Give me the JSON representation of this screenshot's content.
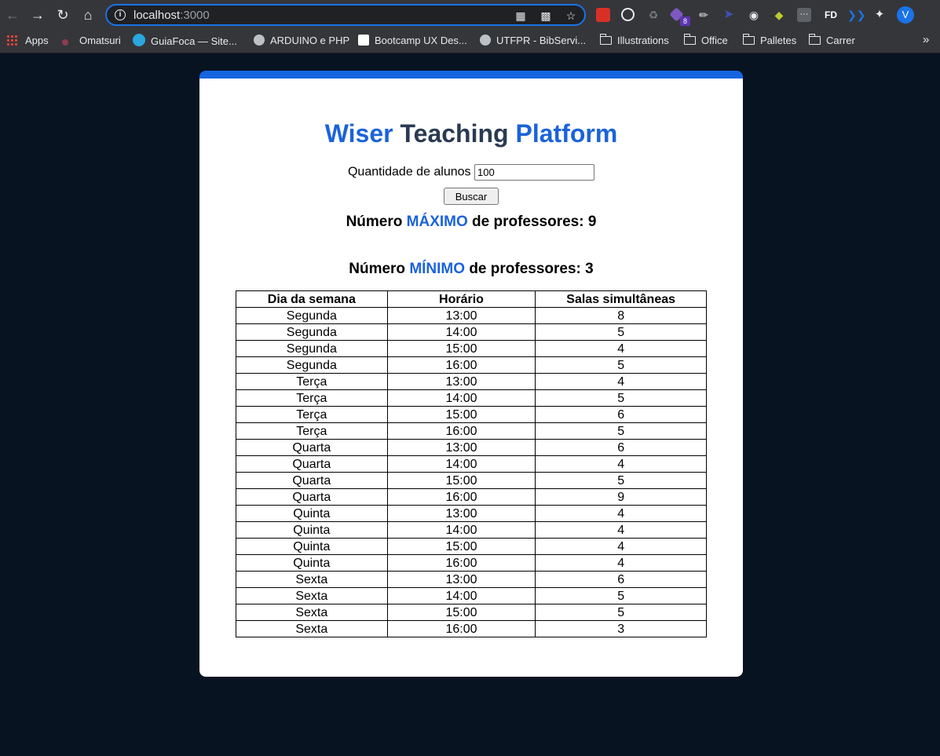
{
  "browser": {
    "url_host": "localhost",
    "url_port": ":3000",
    "avatar_letter": "V",
    "extension_badge": "8",
    "bookmarks": [
      "Apps",
      "Omatsuri",
      "GuiaFoca — Site...",
      "ARDUINO e PHP",
      "Bootcamp UX Des...",
      "UTFPR - BibServi...",
      "Illustrations",
      "Office",
      "Palletes",
      "Carrer"
    ],
    "more_bookmarks": "»"
  },
  "page": {
    "title_part1": "Wiser",
    "title_part2": "Teaching",
    "title_part3": "Platform",
    "input_label": "Quantidade de alunos",
    "input_value": "100",
    "search_button": "Buscar",
    "max_prefix": "Número",
    "max_accent": "MÁXIMO",
    "max_suffix": "de professores: 9",
    "min_prefix": "Número",
    "min_accent": "MÍNIMO",
    "min_suffix": "de professores: 3",
    "accent_color": "#1b63db",
    "table_headers": [
      "Dia da semana",
      "Horário",
      "Salas simultâneas"
    ],
    "table_rows": [
      [
        "Segunda",
        "13:00",
        "8"
      ],
      [
        "Segunda",
        "14:00",
        "5"
      ],
      [
        "Segunda",
        "15:00",
        "4"
      ],
      [
        "Segunda",
        "16:00",
        "5"
      ],
      [
        "Terça",
        "13:00",
        "4"
      ],
      [
        "Terça",
        "14:00",
        "5"
      ],
      [
        "Terça",
        "15:00",
        "6"
      ],
      [
        "Terça",
        "16:00",
        "5"
      ],
      [
        "Quarta",
        "13:00",
        "6"
      ],
      [
        "Quarta",
        "14:00",
        "4"
      ],
      [
        "Quarta",
        "15:00",
        "5"
      ],
      [
        "Quarta",
        "16:00",
        "9"
      ],
      [
        "Quinta",
        "13:00",
        "4"
      ],
      [
        "Quinta",
        "14:00",
        "4"
      ],
      [
        "Quinta",
        "15:00",
        "4"
      ],
      [
        "Quinta",
        "16:00",
        "4"
      ],
      [
        "Sexta",
        "13:00",
        "6"
      ],
      [
        "Sexta",
        "14:00",
        "5"
      ],
      [
        "Sexta",
        "15:00",
        "5"
      ],
      [
        "Sexta",
        "16:00",
        "3"
      ]
    ]
  }
}
